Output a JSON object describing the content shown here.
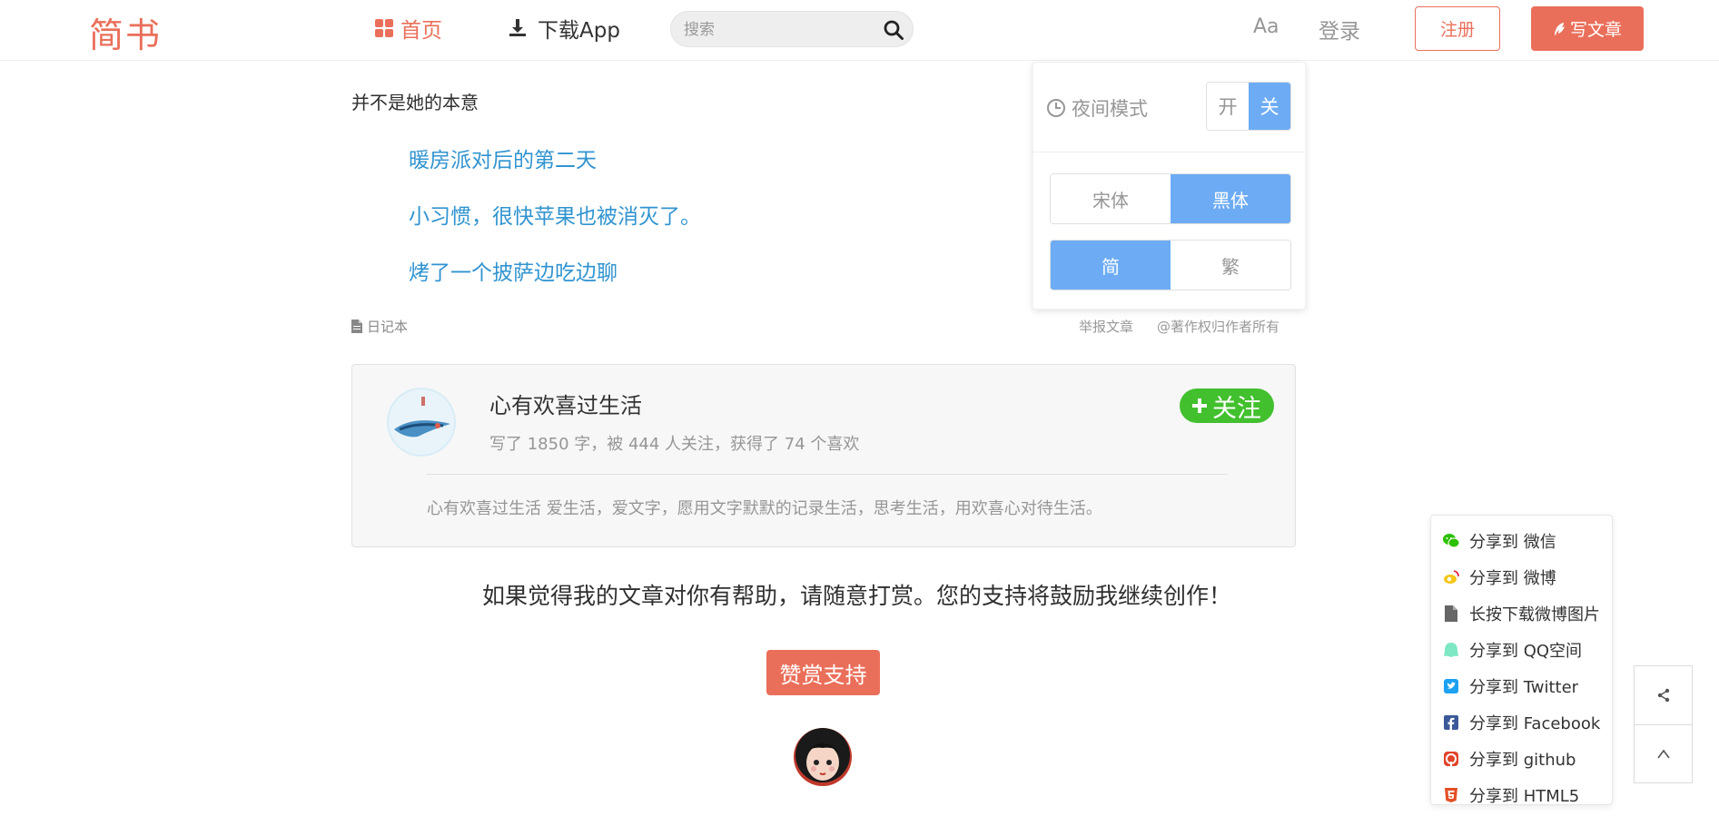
{
  "nav": {
    "logo": "简书",
    "home": "首页",
    "download_app": "下载App",
    "search_placeholder": "搜索",
    "aa": "Aa",
    "login": "登录",
    "signup": "注册",
    "write": "写文章"
  },
  "colors": {
    "brand": "#ea6f5a",
    "link": "#3194d0",
    "toggle_active": "#6dacf4",
    "follow_green": "#42c02e"
  },
  "article": {
    "paragraph": "并不是她的本意",
    "related_links": [
      "暖房派对后的第二天",
      "小习惯，很快苹果也被消灭了。",
      "烤了一个披萨边吃边聊"
    ],
    "notebook": "日记本",
    "report": "举报文章",
    "copyright": "@著作权归作者所有"
  },
  "settings": {
    "night_mode_label": "夜间模式",
    "night_on": "开",
    "night_off": "关",
    "font_song": "宋体",
    "font_hei": "黑体",
    "simplified": "简",
    "traditional": "繁"
  },
  "author": {
    "name": "心有欢喜过生活",
    "stats": "写了 1850 字，被 444 人关注，获得了 74 个喜欢",
    "follow": "关注",
    "intro": "心有欢喜过生活 爱生活，爱文字，愿用文字默默的记录生活，思考生活，用欢喜心对待生活。"
  },
  "reward": {
    "text": "如果觉得我的文章对你有帮助，请随意打赏。您的支持将鼓励我继续创作！",
    "button": "赞赏支持"
  },
  "share": {
    "items": [
      {
        "icon": "wechat-icon",
        "label": "分享到 微信"
      },
      {
        "icon": "weibo-icon",
        "label": "分享到 微博"
      },
      {
        "icon": "file-icon",
        "label": "长按下载微博图片"
      },
      {
        "icon": "qzone-icon",
        "label": "分享到 QQ空间"
      },
      {
        "icon": "twitter-icon",
        "label": "分享到 Twitter"
      },
      {
        "icon": "facebook-icon",
        "label": "分享到 Facebook"
      },
      {
        "icon": "github-icon",
        "label": "分享到 github"
      },
      {
        "icon": "html5-icon",
        "label": "分享到 HTML5"
      }
    ]
  },
  "side_tools": {
    "share_icon": "share-icon",
    "top_icon": "caret-up-icon"
  }
}
